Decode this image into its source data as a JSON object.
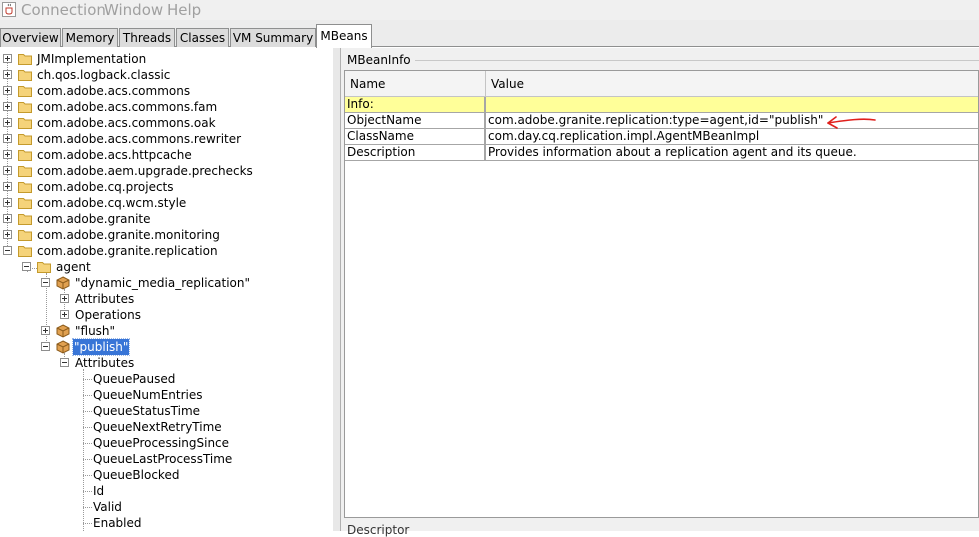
{
  "menubar": {
    "items": [
      "Connection",
      "Window",
      "Help"
    ]
  },
  "tabs": [
    {
      "label": "Overview",
      "active": false
    },
    {
      "label": "Memory",
      "active": false
    },
    {
      "label": "Threads",
      "active": false
    },
    {
      "label": "Classes",
      "active": false
    },
    {
      "label": "VM Summary",
      "active": false
    },
    {
      "label": "MBeans",
      "active": true
    }
  ],
  "tree": {
    "domains": [
      "JMImplementation",
      "ch.qos.logback.classic",
      "com.adobe.acs.commons",
      "com.adobe.acs.commons.fam",
      "com.adobe.acs.commons.oak",
      "com.adobe.acs.commons.rewriter",
      "com.adobe.acs.httpcache",
      "com.adobe.aem.upgrade.prechecks",
      "com.adobe.cq.projects",
      "com.adobe.cq.wcm.style",
      "com.adobe.granite",
      "com.adobe.granite.monitoring",
      "com.adobe.granite.replication"
    ],
    "agent_folder": "agent",
    "beans": {
      "dynamic": "\"dynamic_media_replication\"",
      "flush": "\"flush\"",
      "publish": "\"publish\""
    },
    "attributes_label": "Attributes",
    "operations_label": "Operations",
    "publish_attributes": [
      "QueuePaused",
      "QueueNumEntries",
      "QueueStatusTime",
      "QueueNextRetryTime",
      "QueueProcessingSince",
      "QueueLastProcessTime",
      "QueueBlocked",
      "Id",
      "Valid",
      "Enabled"
    ]
  },
  "mbeaninfo": {
    "title": "MBeanInfo",
    "columns": {
      "name": "Name",
      "value": "Value"
    },
    "rows": [
      {
        "name": "Info:",
        "value": ""
      },
      {
        "name": "ObjectName",
        "value": "com.adobe.granite.replication:type=agent,id=\"publish\""
      },
      {
        "name": "ClassName",
        "value": "com.day.cq.replication.impl.AgentMBeanImpl"
      },
      {
        "name": "Description",
        "value": "Provides information about a replication agent and its queue."
      }
    ]
  },
  "descriptor_title": "Descriptor",
  "colors": {
    "selection": "#3875d7",
    "info_row": "#ffff99",
    "annotation_arrow": "#e0201c",
    "folder": "#f5d37a"
  },
  "icons": {
    "app": "java-cup-icon",
    "folder": "folder-icon",
    "mbean": "mbean-bean-icon",
    "toggle_expand": "tree-expand-icon",
    "toggle_collapse": "tree-collapse-icon",
    "annotation": "red-hand-drawn-arrow-icon"
  }
}
